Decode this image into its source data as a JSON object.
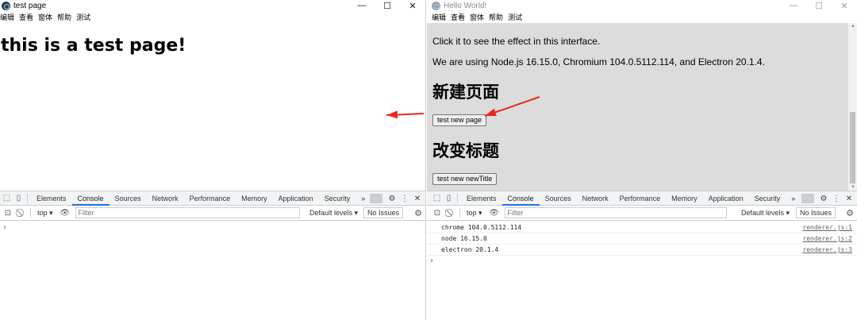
{
  "left_window": {
    "title": "test page",
    "controls": [
      "—",
      "☐",
      "✕"
    ],
    "menu": [
      "编辑",
      "查看",
      "窗体",
      "帮助",
      "测试"
    ],
    "heading": "this is a test page!",
    "devtools": {
      "tabs": [
        "Elements",
        "Console",
        "Sources",
        "Network",
        "Performance",
        "Memory",
        "Application",
        "Security"
      ],
      "active_tab": "Console",
      "more": "»",
      "context": "top",
      "filter_placeholder": "Filter",
      "levels": "Default levels",
      "issues": "No Issues",
      "prompt": "›"
    }
  },
  "right_window": {
    "title": "Hello World!",
    "controls": [
      "—",
      "☐",
      "✕"
    ],
    "menu": [
      "编辑",
      "查看",
      "窗体",
      "帮助",
      "测试"
    ],
    "content": {
      "line1": "Click it to see the effect in this interface.",
      "line2": "We are using Node.js 16.15.0, Chromium 104.0.5112.114, and Electron 20.1.4.",
      "heading1": "新建页面",
      "button1": "test new page",
      "heading2": "改变标题",
      "button2": "test new newTitle"
    },
    "devtools": {
      "tabs": [
        "Elements",
        "Console",
        "Sources",
        "Network",
        "Performance",
        "Memory",
        "Application",
        "Security"
      ],
      "active_tab": "Console",
      "more": "»",
      "context": "top",
      "filter_placeholder": "Filter",
      "levels": "Default levels",
      "issues": "No Issues",
      "logs": [
        {
          "message": "chrome 104.0.5112.114",
          "source": "renderer.js:1"
        },
        {
          "message": "node 16.15.0",
          "source": "renderer.js:2"
        },
        {
          "message": "electron 20.1.4",
          "source": "renderer.js:3"
        }
      ],
      "prompt": "›"
    }
  },
  "annotation_color": "#e8281e"
}
